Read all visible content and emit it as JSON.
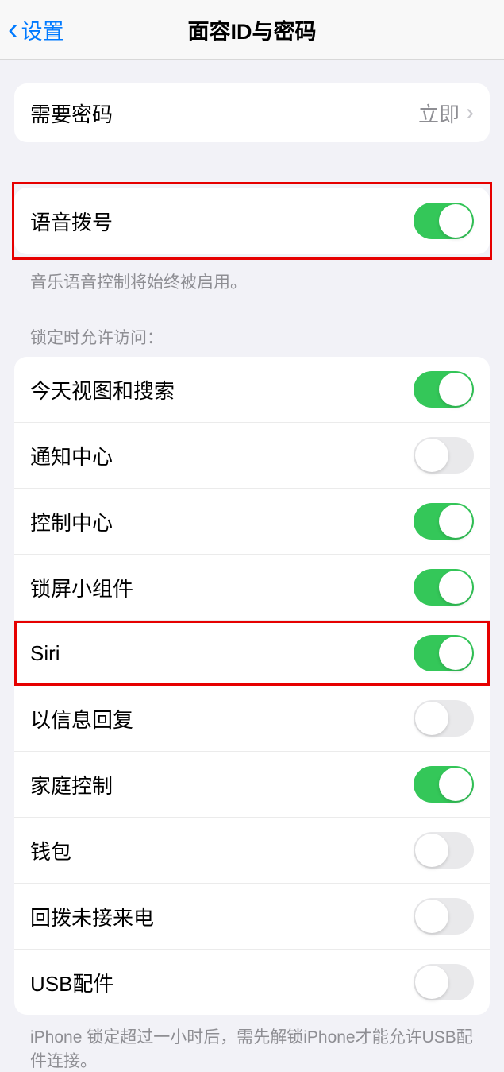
{
  "header": {
    "back_label": "设置",
    "title": "面容ID与密码"
  },
  "require_passcode": {
    "label": "需要密码",
    "value": "立即"
  },
  "voice_dial": {
    "label": "语音拨号",
    "footer": "音乐语音控制将始终被启用。"
  },
  "lock_section": {
    "header": "锁定时允许访问：",
    "items": [
      {
        "label": "今天视图和搜索",
        "on": true
      },
      {
        "label": "通知中心",
        "on": false
      },
      {
        "label": "控制中心",
        "on": true
      },
      {
        "label": "锁屏小组件",
        "on": true
      },
      {
        "label": "Siri",
        "on": true
      },
      {
        "label": "以信息回复",
        "on": false
      },
      {
        "label": "家庭控制",
        "on": true
      },
      {
        "label": "钱包",
        "on": false
      },
      {
        "label": "回拨未接来电",
        "on": false
      },
      {
        "label": "USB配件",
        "on": false
      }
    ],
    "footer": "iPhone 锁定超过一小时后，需先解锁iPhone才能允许USB配件连接。"
  }
}
